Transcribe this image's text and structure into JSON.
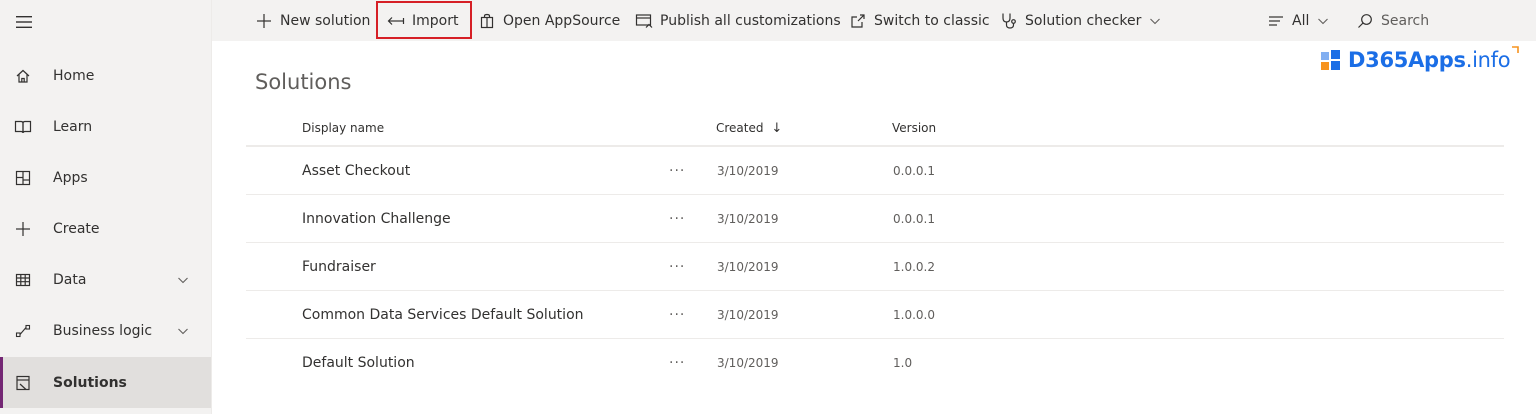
{
  "sidebar": {
    "items": [
      {
        "label": "Home",
        "icon": "home-icon"
      },
      {
        "label": "Learn",
        "icon": "book-icon"
      },
      {
        "label": "Apps",
        "icon": "apps-icon"
      },
      {
        "label": "Create",
        "icon": "plus-icon"
      },
      {
        "label": "Data",
        "icon": "table-icon",
        "expandable": true
      },
      {
        "label": "Business logic",
        "icon": "flow-icon",
        "expandable": true
      },
      {
        "label": "Solutions",
        "icon": "solutions-icon",
        "active": true
      }
    ]
  },
  "toolbar": {
    "new_solution": "New solution",
    "import": "Import",
    "open_appsource": "Open AppSource",
    "publish_all": "Publish all customizations",
    "switch_classic": "Switch to classic",
    "solution_checker": "Solution checker",
    "filter": "All",
    "search": "Search"
  },
  "logo": {
    "name": "D365Apps",
    "tld": ".info"
  },
  "page": {
    "title": "Solutions"
  },
  "table": {
    "columns": {
      "display_name": "Display name",
      "created": "Created",
      "created_sort": "↓",
      "version": "Version"
    },
    "more_label": "···",
    "rows": [
      {
        "name": "Asset Checkout",
        "created": "3/10/2019",
        "version": "0.0.0.1"
      },
      {
        "name": "Innovation Challenge",
        "created": "3/10/2019",
        "version": "0.0.0.1"
      },
      {
        "name": "Fundraiser",
        "created": "3/10/2019",
        "version": "1.0.0.2"
      },
      {
        "name": "Common Data Services Default Solution",
        "created": "3/10/2019",
        "version": "1.0.0.0"
      },
      {
        "name": "Default Solution",
        "created": "3/10/2019",
        "version": "1.0"
      }
    ]
  },
  "colors": {
    "accent": "#742774",
    "highlight": "#d61f26",
    "logo_blue": "#1b6ee6",
    "logo_orange": "#f7931e"
  }
}
